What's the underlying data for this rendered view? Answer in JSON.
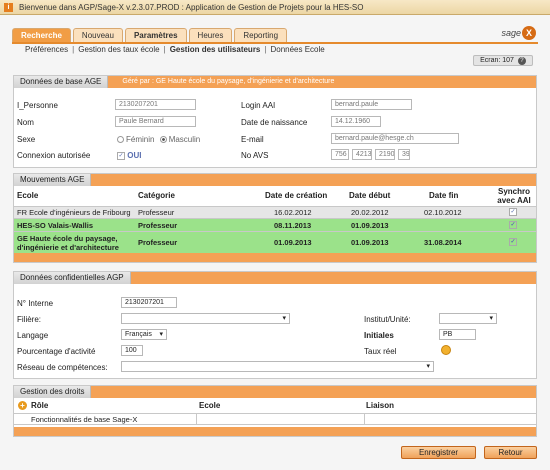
{
  "window": {
    "title": "Bienvenue dans AGP/Sage-X v.2.3.07.PROD : Application de Gestion de Projets pour la HES-SO"
  },
  "nav": {
    "tabs": [
      {
        "label": "Recherche"
      },
      {
        "label": "Nouveau"
      },
      {
        "label": "Paramètres"
      },
      {
        "label": "Heures"
      },
      {
        "label": "Reporting"
      }
    ],
    "logo_text": "sage",
    "logo_mark": "X",
    "subnav": [
      "Préférences",
      "Gestion des taux école",
      "Gestion des utilisateurs",
      "Données Ecole"
    ],
    "separator": "|"
  },
  "ecran": {
    "label": "Ecran: 107",
    "help": "?"
  },
  "base": {
    "title": "Données de base AGE",
    "banner": "Géré par : GE Haute école du paysage, d'ingénierie et d'architecture",
    "personne_label": "I_Personne",
    "personne_value": "2130207201",
    "nom_label": "Nom",
    "nom_value": "Paule Bernard",
    "sexe_label": "Sexe",
    "feminin": "Féminin",
    "masculin": "Masculin",
    "connexion_label": "Connexion autorisée",
    "connexion_value": "OUI",
    "login_label": "Login AAI",
    "login_value": "bernard.paule",
    "naissance_label": "Date de naissance",
    "naissance_value": "14.12.1960",
    "email_label": "E-mail",
    "email_value": "bernard.paule@hesge.ch",
    "avs_label": "No AVS",
    "avs_parts": [
      "756",
      "4213",
      "2190",
      "39"
    ]
  },
  "mouvements": {
    "title": "Mouvements AGE",
    "headers": [
      "Ecole",
      "Catégorie",
      "Date de création",
      "Date début",
      "Date fin",
      "Synchro avec AAI"
    ],
    "rows": [
      {
        "ecole": "FR Ecole d'ingénieurs de Fribourg",
        "categorie": "Professeur",
        "creation": "16.02.2012",
        "debut": "20.02.2012",
        "fin": "02.10.2012",
        "sync": "✓"
      },
      {
        "ecole": "HES-SO Valais-Wallis",
        "categorie": "Professeur",
        "creation": "08.11.2013",
        "debut": "01.09.2013",
        "fin": "",
        "sync": "✓"
      },
      {
        "ecole": "GE Haute école du paysage, d'ingénierie et d'architecture",
        "categorie": "Professeur",
        "creation": "01.09.2013",
        "debut": "01.09.2013",
        "fin": "31.08.2014",
        "sync": "✓"
      }
    ]
  },
  "confid": {
    "title": "Données confidentielles AGP",
    "interne_label": "N° Interne",
    "interne_value": "2130207201",
    "filiere_label": "Filière:",
    "institut_label": "Institut/Unité:",
    "langage_label": "Langage",
    "langage_value": "Français",
    "initiales_label": "Initiales",
    "initiales_value": "PB",
    "pourcentage_label": "Pourcentage d'activité",
    "pourcentage_value": "100",
    "taux_label": "Taux réel",
    "reseau_label": "Réseau de compétences:"
  },
  "droits": {
    "title": "Gestion des droits",
    "headers": [
      "Rôle",
      "Ecole",
      "Liaison"
    ],
    "rows": [
      {
        "role": "Fonctionnalités de base Sage-X",
        "ecole": "",
        "liaison": ""
      }
    ]
  },
  "buttons": {
    "enregistrer": "Enregistrer",
    "retour": "Retour"
  },
  "colors": {
    "accent": "#f4a155",
    "highlight_row": "#9be28a",
    "selected_row": "#e6e6e6"
  }
}
